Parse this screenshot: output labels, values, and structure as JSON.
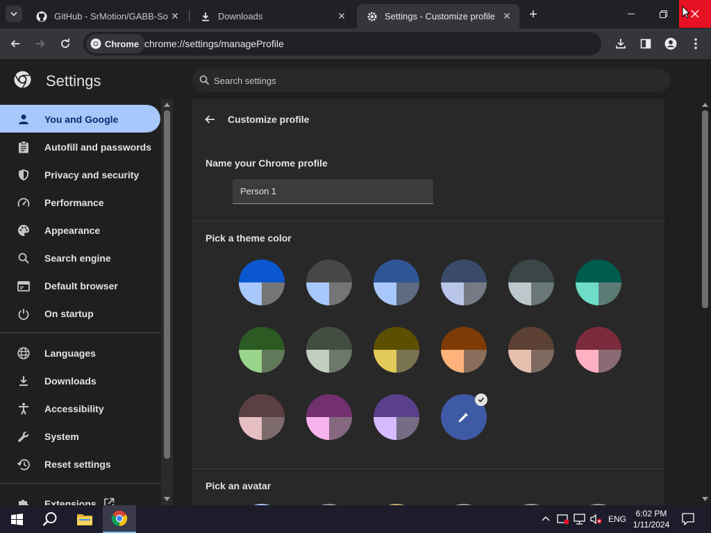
{
  "tabs": [
    {
      "title": "GitHub - SrMotion/GABB-Sourc",
      "icon": "github-icon"
    },
    {
      "title": "Downloads",
      "icon": "download-icon"
    },
    {
      "title": "Settings - Customize profile",
      "icon": "gear-icon"
    }
  ],
  "toolbar": {
    "chip_label": "Chrome",
    "url": "chrome://settings/manageProfile"
  },
  "settings": {
    "title": "Settings",
    "search_placeholder": "Search settings"
  },
  "sidebar": {
    "items": [
      {
        "label": "You and Google",
        "icon": "person-icon",
        "selected": true
      },
      {
        "label": "Autofill and passwords",
        "icon": "clipboard-icon"
      },
      {
        "label": "Privacy and security",
        "icon": "shield-icon"
      },
      {
        "label": "Performance",
        "icon": "speedometer-icon"
      },
      {
        "label": "Appearance",
        "icon": "palette-icon"
      },
      {
        "label": "Search engine",
        "icon": "search-icon"
      },
      {
        "label": "Default browser",
        "icon": "browser-icon"
      },
      {
        "label": "On startup",
        "icon": "power-icon"
      },
      {
        "label": "Languages",
        "icon": "globe-icon"
      },
      {
        "label": "Downloads",
        "icon": "download-icon"
      },
      {
        "label": "Accessibility",
        "icon": "accessibility-icon"
      },
      {
        "label": "System",
        "icon": "wrench-icon"
      },
      {
        "label": "Reset settings",
        "icon": "history-icon"
      },
      {
        "label": "Extensions",
        "icon": "puzzle-icon"
      }
    ]
  },
  "customize": {
    "back_label": "Customize profile",
    "name_section": "Name your Chrome profile",
    "name_value": "Person 1",
    "theme_section": "Pick a theme color",
    "avatar_section": "Pick an avatar",
    "swatches": [
      {
        "top": "#0b57d0",
        "bl": "#a8c7fa",
        "br": "#757575"
      },
      {
        "top": "#474747",
        "bl": "#a8c7fa",
        "br": "#757575"
      },
      {
        "top": "#2f5597",
        "bl": "#a8c7fa",
        "br": "#5f6b82"
      },
      {
        "top": "#3b4a68",
        "bl": "#b9c6e9",
        "br": "#757a85"
      },
      {
        "top": "#3a4648",
        "bl": "#bcc8cc",
        "br": "#6b7879"
      },
      {
        "top": "#005c4f",
        "bl": "#6fdcc8",
        "br": "#5b7c75"
      },
      {
        "top": "#2b5a22",
        "bl": "#9ad48a",
        "br": "#617a5b"
      },
      {
        "top": "#434e42",
        "bl": "#c3cfbe",
        "br": "#6c786a"
      },
      {
        "top": "#5c4f00",
        "bl": "#e3c957",
        "br": "#7a7350"
      },
      {
        "top": "#7e3b06",
        "bl": "#ffb27a",
        "br": "#8a6d5a"
      },
      {
        "top": "#5c4034",
        "bl": "#e5c0ae",
        "br": "#7f6a61"
      },
      {
        "top": "#7c2b3d",
        "bl": "#ffb1c4",
        "br": "#8a6a72"
      },
      {
        "top": "#5b3f43",
        "bl": "#e7bfc3",
        "br": "#7e6b6d"
      },
      {
        "top": "#72306e",
        "bl": "#f8b3ee",
        "br": "#85687f"
      },
      {
        "top": "#5a3f8a",
        "bl": "#d6bcff",
        "br": "#776c86"
      }
    ],
    "custom_color": "#3e5aa5"
  },
  "taskbar": {
    "lang": "ENG",
    "time": "6:02 PM",
    "date": "1/11/2024"
  }
}
